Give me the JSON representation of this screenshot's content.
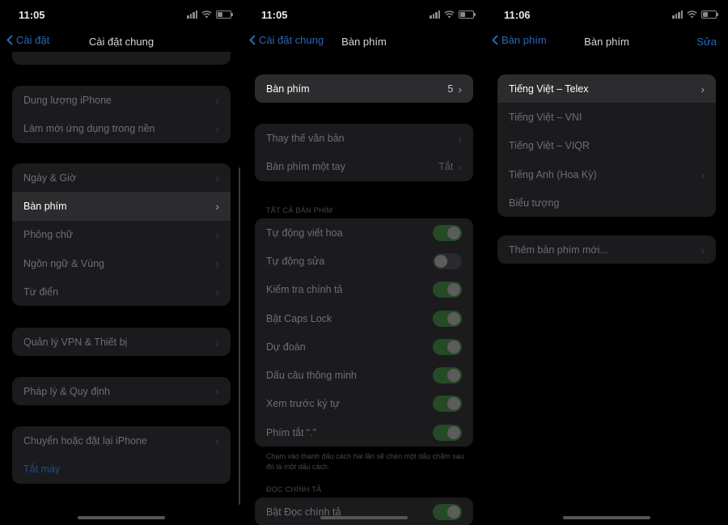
{
  "s1": {
    "time": "11:05",
    "back": "Cài đặt",
    "title": "Cài đặt chung",
    "groups": [
      [
        "Dung lượng iPhone",
        "Làm mới ứng dụng trong nền"
      ],
      [
        "Ngày & Giờ",
        "Bàn phím",
        "Phông chữ",
        "Ngôn ngữ & Vùng",
        "Từ điển"
      ],
      [
        "Quản lý VPN & Thiết bị"
      ],
      [
        "Pháp lý & Quy định"
      ],
      [
        "Chuyển hoặc đặt lại iPhone",
        "Tắt máy"
      ]
    ]
  },
  "s2": {
    "time": "11:05",
    "back": "Cài đặt chung",
    "title": "Bàn phím",
    "keyboards_label": "Bàn phím",
    "keyboards_count": "5",
    "text_replacement": "Thay thế văn bản",
    "one_handed": "Bàn phím một tay",
    "one_handed_value": "Tắt",
    "section_all": "TẤT CẢ BÀN PHÍM",
    "toggles": [
      {
        "label": "Tự động viết hoa",
        "on": true
      },
      {
        "label": "Tự động sửa",
        "on": false
      },
      {
        "label": "Kiểm tra chính tả",
        "on": true
      },
      {
        "label": "Bật Caps Lock",
        "on": true
      },
      {
        "label": "Dự đoán",
        "on": true
      },
      {
        "label": "Dấu câu thông minh",
        "on": true
      },
      {
        "label": "Xem trước ký tự",
        "on": true
      },
      {
        "label": "Phím tắt “.”",
        "on": true
      }
    ],
    "footnote": "Chạm vào thanh dấu cách hai lần sẽ chèn một dấu chấm sau đó là một dấu cách.",
    "section_dictation": "ĐỌC CHÍNH TẢ",
    "dictation_label": "Bật Đọc chính tả",
    "dictation_on": true
  },
  "s3": {
    "time": "11:06",
    "back": "Bàn phím",
    "title": "Bàn phím",
    "edit": "Sửa",
    "keyboards": [
      "Tiếng Việt – Telex",
      "Tiếng Việt – VNI",
      "Tiếng Việt – VIQR",
      "Tiếng Anh (Hoa Kỳ)",
      "Biểu tượng"
    ],
    "add_new": "Thêm bàn phím mới..."
  },
  "colors": {
    "accent": "#2c66b8",
    "toggle_on": "#254a26",
    "cell": "#1b1b1d",
    "highlight": "#2c2c2e"
  }
}
